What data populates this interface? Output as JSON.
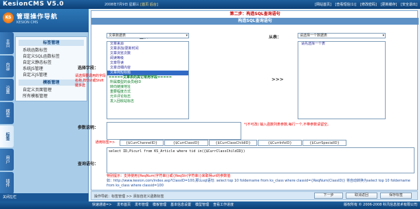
{
  "header": {
    "brand": "KesionCMS V5.0",
    "date": "2008年7月9日 星期三",
    "home_link": "[首页 后台]",
    "links": [
      "[网站首页]",
      "[查看短信(1)]",
      "[修改密码]",
      "[更新缓存]",
      "[安全退出]"
    ]
  },
  "sidebar": {
    "logo_mark": "KS",
    "logo_title": "管理操作导航",
    "logo_sub": "KESION CMS",
    "tabs": [
      "主页",
      "内容",
      "设置",
      "模型",
      "标签",
      "用户",
      "插件"
    ],
    "menu_head1": "标签管理",
    "menu": [
      "系统函数标签",
      "自定义SQL函数标签",
      "自定义静态标签",
      "系统JS管理",
      "自定义JS管理"
    ],
    "menu_head2": "模板管理",
    "menu2": [
      "自定义页面管理",
      "所有模板管理"
    ],
    "foot": "关闭左栏"
  },
  "main": {
    "step": "第二步：构造SQL查询语句",
    "title": "构造SQL查询语句",
    "main_table_label": "主表：",
    "main_table_value": "文章数据表",
    "sub_table_label": "从表：",
    "sub_table_value": "请选择一个数据表",
    "sub_table_hint": "请先选择一个表",
    "select_fields_label": "选择字段：",
    "select_fields_hint": "请选择要调用的字段名称,按Ctrl或Shift键多选",
    "fields": [
      "文章来源",
      "文章添加/更新时间",
      "文章浏览次数",
      "阅读等级",
      "文章导读",
      "文章详细内容",
      "文章简短标题"
    ],
    "fields_group": "=====文章表的其它常用字段=====",
    "fields2": [
      "所属模型的会员组ID",
      "转向链接地址",
      "重要程度方式",
      "允许评论标志",
      "发入回收站标志"
    ],
    "arrow": ">>>",
    "params_label": "参数说明：",
    "params_hint": "*(不可改) 输入函数列表参数,每行一个,不带参数请留空。",
    "special_label": "通用标签=>",
    "vars": [
      "{$CurrChannelID}",
      "{$CurrClassID}",
      "{$CurrClassChildID}",
      "{$CurrInfoID}",
      "{$CurrSpecialID}"
    ],
    "query_label": "查询语句：",
    "query": "select ID,Picurl from KS_Article where tid in({$CurrClassChildID})",
    "note1": "特别提示：支持使用{ReqNum(字符串)}或{ReqStr(字符串)}来取得url的参数值",
    "note2": "如：http://www.kesion.com/index.asp?ClassID=100,那么sql语句: select top 10 foldername from ks_class where classid={ReqNum(ClassID)} 将自动转换为select top 10 foldername from ks_class where classid=100"
  },
  "bottom": {
    "location": "操作导航：标签管理 >> 添加自定义函数标签",
    "buttons": [
      "下一步",
      "取消返回",
      "保存标签"
    ]
  },
  "footer": {
    "label": "快速通道=>",
    "links": [
      "发布首页",
      "发布管理",
      "模板管理",
      "基本信息设置",
      "模型管理",
      "查看工作进度"
    ],
    "copy": "版权所有 © 2006-2008 科汛信息技术有限公司"
  }
}
